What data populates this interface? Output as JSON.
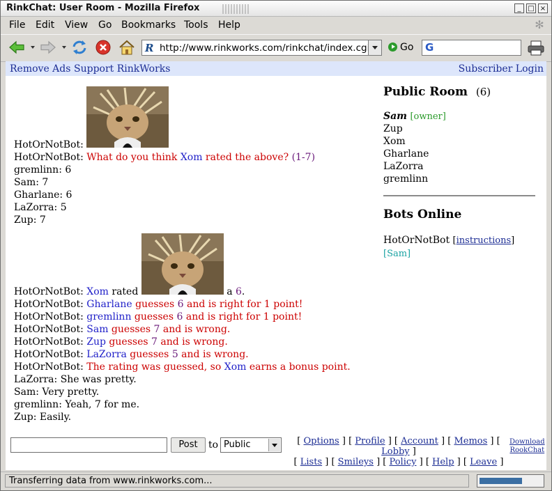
{
  "window": {
    "title": "RinkChat: User Room - Mozilla Firefox",
    "btn_min": "_",
    "btn_max": "□",
    "btn_close": "×"
  },
  "menu": [
    "File",
    "Edit",
    "View",
    "Go",
    "Bookmarks",
    "Tools",
    "Help"
  ],
  "toolbar": {
    "url": "http://www.rinkworks.com/rinkchat/index.cgi",
    "go_label": "Go",
    "search_glyph": "G"
  },
  "topnav": {
    "remove_ads": "Remove Ads",
    "support": "Support RinkWorks",
    "login": "Subscriber Login"
  },
  "chat": {
    "round1": {
      "bot": "HotOrNotBot",
      "question_pre": "What do you think ",
      "question_name": "Xom",
      "question_mid": " rated the above? ",
      "question_range": "(1-7)",
      "guesses": [
        {
          "name": "gremlinn",
          "text": ": 6"
        },
        {
          "name": "Sam",
          "text": ": 7"
        },
        {
          "name": "Gharlane",
          "text": ": 6"
        },
        {
          "name": "LaZorra",
          "text": ": 5"
        },
        {
          "name": "Zup",
          "text": ": 7"
        }
      ]
    },
    "round2": {
      "bot": "HotOrNotBot",
      "rated_name": "Xom",
      "rated_word": " rated ",
      "rated_a": " a ",
      "rated_value": "6",
      "rated_period": ".",
      "results": [
        {
          "name": "Gharlane",
          "mid": " guesses ",
          "num": "6",
          "tail": " and is right for 1 point!"
        },
        {
          "name": "gremlinn",
          "mid": " guesses ",
          "num": "6",
          "tail": " and is right for 1 point!"
        },
        {
          "name": "Sam",
          "mid": " guesses ",
          "num": "7",
          "tail": " and is wrong."
        },
        {
          "name": "Zup",
          "mid": " guesses ",
          "num": "7",
          "tail": " and is wrong."
        },
        {
          "name": "LaZorra",
          "mid": " guesses ",
          "num": "5",
          "tail": " and is wrong."
        }
      ],
      "bonus_pre": "The rating was guessed, so ",
      "bonus_name": "Xom",
      "bonus_tail": " earns a bonus point.",
      "chatter": [
        {
          "name": "LaZorra",
          "text": ": She was pretty."
        },
        {
          "name": "Sam",
          "text": ": Very pretty."
        },
        {
          "name": "gremlinn",
          "text": ": Yeah, 7 for me."
        },
        {
          "name": "Zup",
          "text": ": Easily."
        }
      ]
    }
  },
  "sidebar": {
    "room_title": "Public Room",
    "room_count": "(6)",
    "owner_name": "Sam",
    "owner_tag": "[owner]",
    "users": [
      "Zup",
      "Xom",
      "Gharlane",
      "LaZorra",
      "gremlinn"
    ],
    "bots_title": "Bots Online",
    "bot_name": "HotOrNotBot",
    "bot_instructions": "instructions",
    "bot_owner": "[Sam]"
  },
  "input": {
    "post_label": "Post",
    "to_label": "to",
    "recipient": "Public"
  },
  "links_row1": [
    "Options",
    "Profile",
    "Account",
    "Memos",
    "Lobby"
  ],
  "links_row2": [
    "Lists",
    "Smileys",
    "Policy",
    "Help",
    "Leave"
  ],
  "download": {
    "line1": "Download",
    "line2": "RookChat"
  },
  "status": {
    "text": "Transferring data from www.rinkworks.com...",
    "progress": 0.68
  },
  "colors": {
    "link": "#1c2d94",
    "bot_red": "#cc0000",
    "name_blue": "#1e1ec8",
    "owner_green": "#2a9a2a"
  }
}
